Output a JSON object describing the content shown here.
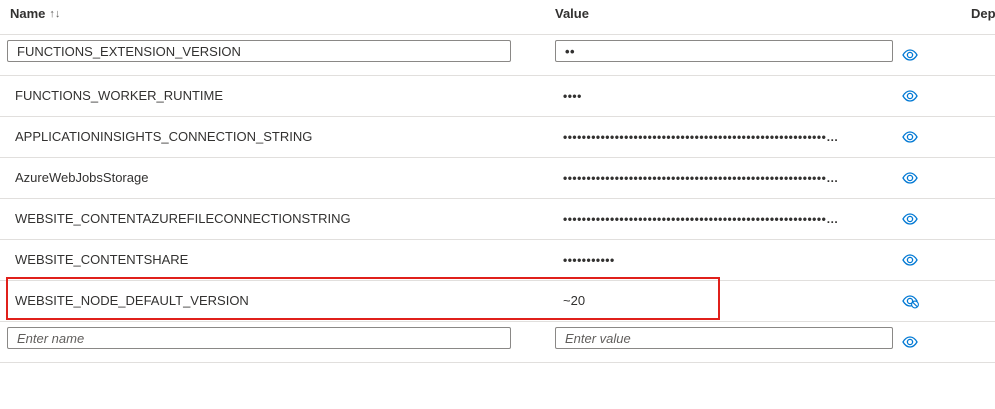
{
  "table": {
    "columns": {
      "name": "Name",
      "value": "Value",
      "deployment": "Dep"
    },
    "rows": [
      {
        "name": "FUNCTIONS_EXTENSION_VERSION",
        "value": "••",
        "editing": true,
        "eye_state": "show"
      },
      {
        "name": "FUNCTIONS_WORKER_RUNTIME",
        "value": "••••",
        "editing": false,
        "eye_state": "show"
      },
      {
        "name": "APPLICATIONINSIGHTS_CONNECTION_STRING",
        "value": "••••••••••••••••••••••••••••••••••••••••••••••••••••••••…",
        "editing": false,
        "eye_state": "show"
      },
      {
        "name": "AzureWebJobsStorage",
        "value": "••••••••••••••••••••••••••••••••••••••••••••••••••••••••…",
        "editing": false,
        "eye_state": "show"
      },
      {
        "name": "WEBSITE_CONTENTAZUREFILECONNECTIONSTRING",
        "value": "••••••••••••••••••••••••••••••••••••••••••••••••••••••••…",
        "editing": false,
        "eye_state": "show"
      },
      {
        "name": "WEBSITE_CONTENTSHARE",
        "value": "•••••••••••",
        "editing": false,
        "eye_state": "show"
      },
      {
        "name": "WEBSITE_NODE_DEFAULT_VERSION",
        "value": "~20",
        "editing": false,
        "eye_state": "hide",
        "highlighted": true
      }
    ],
    "new_row": {
      "name_placeholder": "Enter name",
      "value_placeholder": "Enter value"
    }
  },
  "icons": {
    "sort": "sort-icon",
    "eye": "eye-icon",
    "eye_hide": "eye-hide-icon"
  },
  "colors": {
    "accent": "#0078d4",
    "highlight": "#e0201b",
    "border": "#e1dfdd"
  }
}
